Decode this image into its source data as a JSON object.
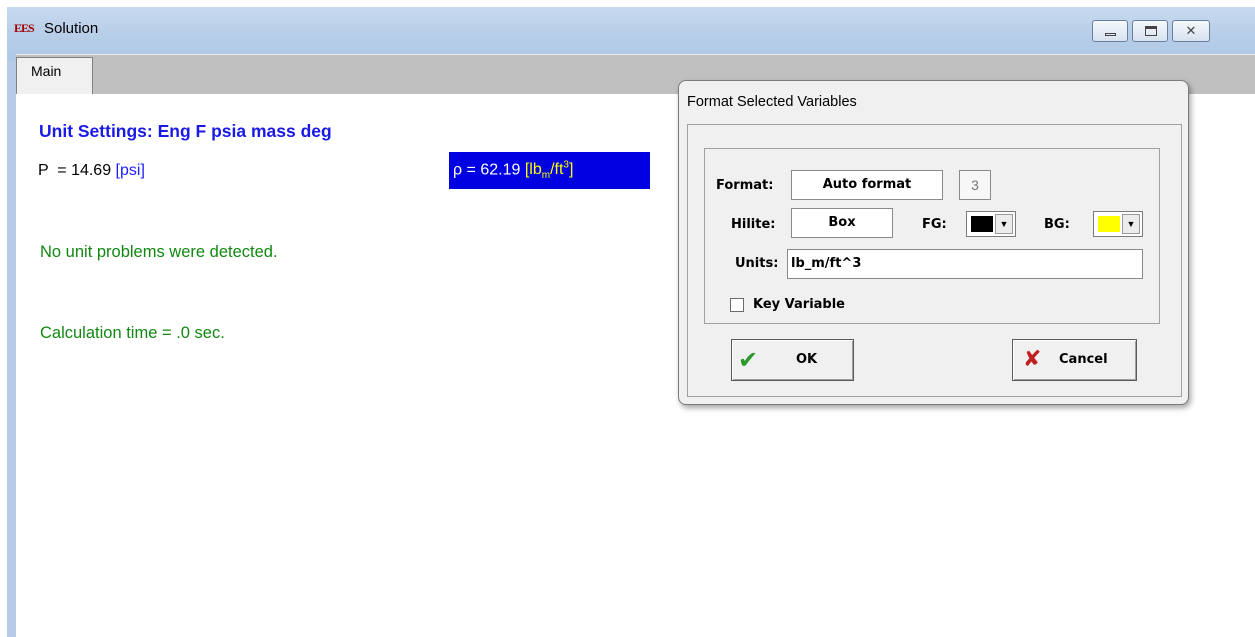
{
  "window": {
    "icon_text": "EES",
    "title": "Solution"
  },
  "tabs": [
    {
      "label": "Main"
    }
  ],
  "solution": {
    "unit_settings": "Unit Settings: Eng F psia mass deg",
    "p_line": "P  = 14.69 ",
    "p_unit": "[psi]",
    "rho_value": "ρ = 62.19 ",
    "rho_unit_pre": "[lb",
    "rho_unit_sub": "m",
    "rho_unit_mid": "/ft",
    "rho_unit_sup": "3",
    "rho_unit_post": "]",
    "no_unit_problems": "No unit problems were detected.",
    "calc_time": "Calculation time = .0 sec."
  },
  "dialog": {
    "title": "Format Selected Variables",
    "format_label": "Format:",
    "format_value": "Auto format",
    "digits": "3",
    "hilite_label": "Hilite:",
    "hilite_value": "Box",
    "fg_label": "FG:",
    "fg_color": "#000000",
    "bg_label": "BG:",
    "bg_color": "#ffff00",
    "units_label": "Units:",
    "units_value": "lb_m/ft^3",
    "key_variable_label": "Key Variable",
    "key_variable_checked": false,
    "ok_label": "OK",
    "cancel_label": "Cancel"
  },
  "icons": [
    "minimize-icon",
    "maximize-icon",
    "close-icon",
    "checkmark-icon",
    "x-icon",
    "dropdown-arrow-icon"
  ],
  "colors": {
    "titlebar": "#b9cfe9",
    "unit_settings_text": "#1a1ae6",
    "highlight_box": "#0000e0",
    "highlight_unit": "#ffff00",
    "status_text": "#118811"
  }
}
